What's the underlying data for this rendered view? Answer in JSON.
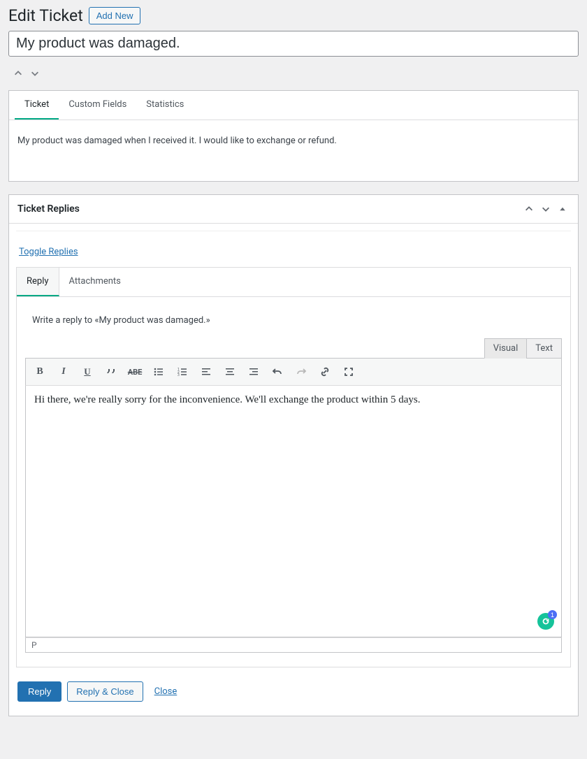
{
  "header": {
    "title": "Edit Ticket",
    "add_new_label": "Add New"
  },
  "ticket": {
    "title_value": "My product was damaged.",
    "body": "My product was damaged when I received it. I would like to exchange or refund."
  },
  "tabs": {
    "ticket": "Ticket",
    "custom_fields": "Custom Fields",
    "statistics": "Statistics"
  },
  "replies_panel": {
    "title": "Ticket Replies",
    "toggle_link": "Toggle Replies",
    "reply_tab": "Reply",
    "attachments_tab": "Attachments",
    "prompt": "Write a reply to «My product was damaged.»",
    "mode_visual": "Visual",
    "mode_text": "Text",
    "editor_content": "Hi there, we're really sorry for the inconvenience. We'll exchange the product within 5 days.",
    "status_path": "P",
    "grammarly_count": "1"
  },
  "toolbar": {
    "bold": "bold-icon",
    "italic": "italic-icon",
    "underline": "underline-icon",
    "quote": "quote-icon",
    "strike": "ABE",
    "ul": "bullet-list-icon",
    "ol": "numbered-list-icon",
    "align_left": "align-left-icon",
    "align_center": "align-center-icon",
    "align_right": "align-right-icon",
    "undo": "undo-icon",
    "redo": "redo-icon",
    "link": "link-icon",
    "fullscreen": "fullscreen-icon"
  },
  "actions": {
    "reply": "Reply",
    "reply_close": "Reply & Close",
    "close": "Close"
  }
}
